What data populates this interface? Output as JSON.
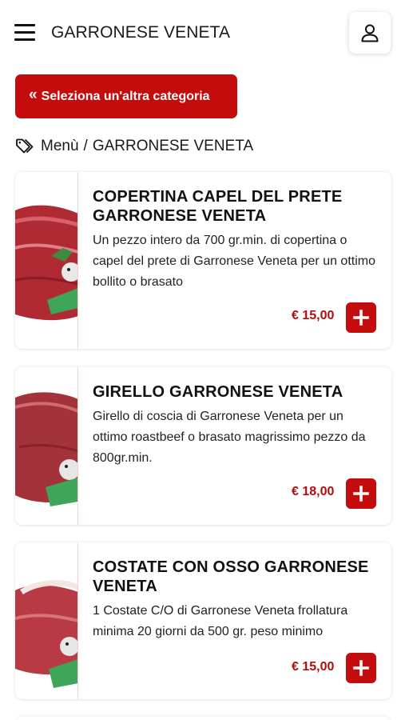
{
  "header": {
    "title": "GARRONESE VENETA",
    "menu_icon": "hamburger-menu-icon",
    "account_icon": "user-icon"
  },
  "back_button": {
    "chevron": "«",
    "label": "Seleziona un'altra categoria"
  },
  "breadcrumb": {
    "icon": "tags-icon",
    "root": "Menù",
    "separator": "/",
    "current": "GARRONESE VENETA"
  },
  "colors": {
    "accent": "#c40c0c",
    "price": "#b30c0c"
  },
  "products": [
    {
      "name": "COPERTINA CAPEL DEL PRETE GARRONESE VENETA",
      "description": "Un pezzo intero da 700 gr.min. di copertina o capel del prete di Garronese Veneta per un ottimo bollito o brasato",
      "price": "€ 15,00"
    },
    {
      "name": "GIRELLO GARRONESE VENETA",
      "description": "Girello di coscia di Garronese Veneta per un ottimo roastbeef o brasato magrissimo pezzo da 800gr.min.",
      "price": "€ 18,00"
    },
    {
      "name": "COSTATE CON OSSO GARRONESE VENETA",
      "description": "1 Costate C/O di Garronese Veneta frollatura minima 20 giorni da 500 gr. peso minimo",
      "price": "€ 15,00"
    }
  ]
}
